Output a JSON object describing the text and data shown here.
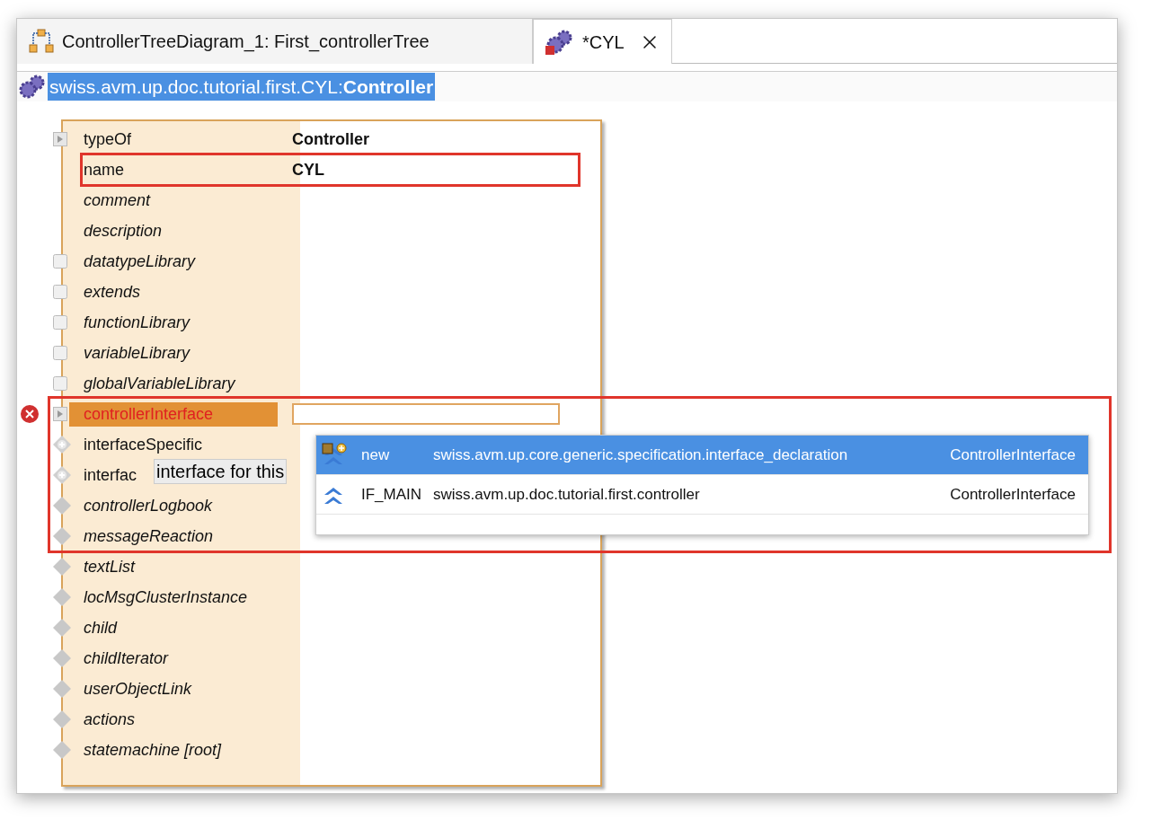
{
  "tabs": [
    {
      "label": "ControllerTreeDiagram_1: First_controllerTree",
      "selected": false,
      "kind": "diagram",
      "closable": false
    },
    {
      "label": "*CYL",
      "selected": true,
      "kind": "gears-error",
      "closable": true
    }
  ],
  "breadcrumb": {
    "text": "swiss.avm.up.doc.tutorial.first.CYL:**Controller**",
    "selected": true
  },
  "properties": [
    {
      "label": "typeOf",
      "value": "Controller",
      "kind": "arrow",
      "italic": false,
      "error": false,
      "outlined": false
    },
    {
      "label": "name",
      "value": "CYL",
      "kind": "none",
      "italic": false,
      "error": false,
      "outlined": true
    },
    {
      "label": "comment",
      "kind": "none",
      "italic": true,
      "error": false,
      "outlined": false
    },
    {
      "label": "description",
      "kind": "none",
      "italic": true,
      "error": false,
      "outlined": false
    },
    {
      "label": "datatypeLibrary",
      "kind": "box",
      "italic": true,
      "error": false,
      "outlined": false
    },
    {
      "label": "extends",
      "kind": "box",
      "italic": true,
      "error": false,
      "outlined": false
    },
    {
      "label": "functionLibrary",
      "kind": "box",
      "italic": true,
      "error": false,
      "outlined": false
    },
    {
      "label": "variableLibrary",
      "kind": "box",
      "italic": true,
      "error": false,
      "outlined": false
    },
    {
      "label": "globalVariableLibrary",
      "kind": "box",
      "italic": true,
      "error": false,
      "outlined": false
    },
    {
      "label": "controllerInterface",
      "kind": "arrow",
      "italic": false,
      "error": true,
      "outlined": false,
      "editing": true
    },
    {
      "label": "interfaceSpecific",
      "kind": "plus",
      "italic": false,
      "error": false,
      "outlined": false
    },
    {
      "label": "interfac",
      "kind": "plus",
      "italic": false,
      "error": false,
      "outlined": false
    },
    {
      "label": "controllerLogbook",
      "kind": "diamond",
      "italic": true,
      "error": false,
      "outlined": false
    },
    {
      "label": "messageReaction",
      "kind": "diamond",
      "italic": true,
      "error": false,
      "outlined": false
    },
    {
      "label": "textList",
      "kind": "diamond",
      "italic": true,
      "error": false,
      "outlined": false
    },
    {
      "label": "locMsgClusterInstance",
      "kind": "diamond",
      "italic": true,
      "error": false,
      "outlined": false
    },
    {
      "label": "child",
      "kind": "diamond",
      "italic": true,
      "error": false,
      "outlined": false
    },
    {
      "label": "childIterator",
      "kind": "diamond",
      "italic": true,
      "error": false,
      "outlined": false
    },
    {
      "label": "userObjectLink",
      "kind": "diamond",
      "italic": true,
      "error": false,
      "outlined": false
    },
    {
      "label": "actions",
      "kind": "diamond",
      "italic": true,
      "error": false,
      "outlined": false
    },
    {
      "label": "statemachine [root]",
      "kind": "diamond",
      "italic": true,
      "error": false,
      "outlined": false
    }
  ],
  "tooltip": {
    "text": "interface for this"
  },
  "completion": {
    "outlined": true,
    "items": [
      {
        "name": "new",
        "package": "swiss.avm.up.core.generic.specification.interface_declaration",
        "type": "ControllerInterface",
        "selected": true,
        "kind": "new"
      },
      {
        "name": "IF_MAIN",
        "package": "swiss.avm.up.doc.tutorial.first.controller",
        "type": "ControllerInterface",
        "selected": false,
        "kind": "interface"
      }
    ]
  }
}
